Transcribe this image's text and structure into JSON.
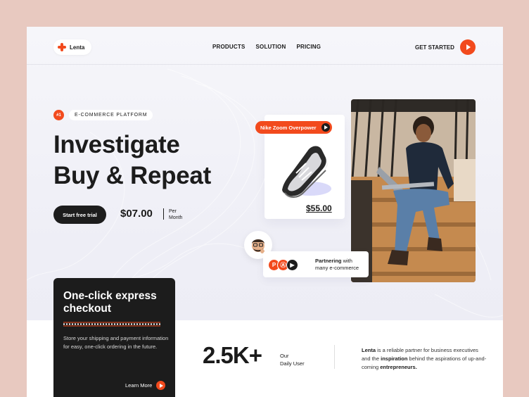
{
  "nav": {
    "brand": "Lenta",
    "menu": [
      "PRODUCTS",
      "SOLUTION",
      "PRICING"
    ],
    "cta_label": "GET STARTED"
  },
  "hero": {
    "tag_number": "#1",
    "tag_label": "E-COMMERCE PLATFORM",
    "headline_line1": "Investigate",
    "headline_line2": "Buy & Repeat",
    "trial_button": "Start free trial",
    "price": "$07.00",
    "price_unit_line1": "Per",
    "price_unit_line2": "Month"
  },
  "product": {
    "name": "Nike Zoom Overpower",
    "price": "$55.00"
  },
  "partners": {
    "title": "Partnering",
    "suffix": " with",
    "line2": "many e-commerce",
    "icons": [
      "P",
      "Ⓐ",
      "▶"
    ]
  },
  "checkout": {
    "title": "One-click express checkout",
    "description": "Store your shipping and payment information for easy, one-click ordering in the future.",
    "link": "Learn More"
  },
  "stats": {
    "value": "2.5K+",
    "label_line1": "Our",
    "label_line2": "Daily User"
  },
  "about": {
    "brand": "Lenta",
    "text1": " is a reliable partner for business executives and the ",
    "highlight1": "inspiration",
    "text2": " behind the aspirations of up-and-coming ",
    "highlight2": "entrepreneurs."
  },
  "colors": {
    "accent": "#f24a1d",
    "dark": "#1d1d1d",
    "page_bg": "#e8c9c0"
  }
}
